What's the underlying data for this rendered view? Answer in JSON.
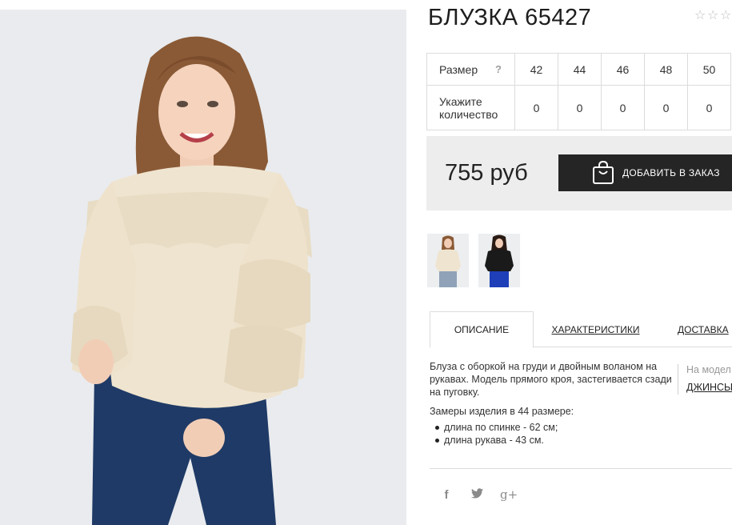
{
  "product": {
    "title": "БЛУЗКА 65427",
    "rating_stars": [
      "☆",
      "☆",
      "☆"
    ]
  },
  "size_table": {
    "size_label": "Размер",
    "help_label": "?",
    "sizes": [
      "42",
      "44",
      "46",
      "48",
      "50"
    ],
    "quantity_label": "Укажите количество",
    "quantities": [
      "0",
      "0",
      "0",
      "0",
      "0"
    ]
  },
  "order": {
    "price": "755 руб",
    "add_button_label": "ДОБАВИТЬ В ЗАКАЗ"
  },
  "tabs": {
    "description": "ОПИСАНИЕ",
    "specs": "ХАРАКТЕРИСТИКИ",
    "delivery": "ДОСТАВКА"
  },
  "description": {
    "text": "Блуза с оборкой на груди и двойным воланом на рукавах. Модель прямого кроя, застегивается сзади на пуговку.",
    "measurements_title": "Замеры изделия в 44 размере:",
    "measurements": [
      "длина по спинке - 62 см;",
      "длина рукава - 43 см."
    ]
  },
  "model_info": {
    "label": "На модел",
    "link": "ДЖИНСЫ"
  },
  "social": {
    "facebook": "f",
    "twitter": "twitter-icon",
    "googleplus": "g+"
  },
  "colors": {
    "button_bg": "#252525",
    "order_box_bg": "#ededed",
    "photo_bg": "#e9ebee",
    "blouse": "#efe4cf",
    "jeans": "#1f3a66",
    "hair": "#8a5a36"
  }
}
